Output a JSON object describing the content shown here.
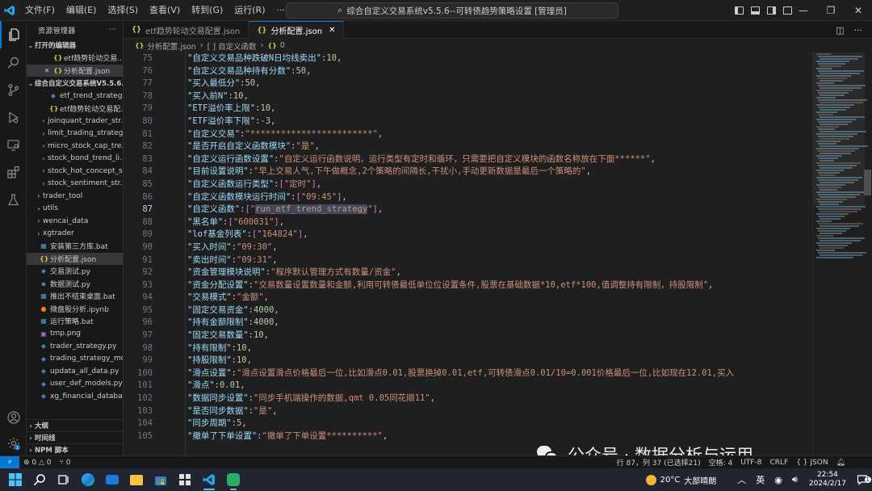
{
  "titlebar": {
    "menu": [
      "文件(F)",
      "编辑(E)",
      "选择(S)",
      "查看(V)",
      "转到(G)",
      "运行(R)",
      "···"
    ],
    "search_text": "综合自定义交易系统v5.5.6--可转债趋势策略设置 [管理员]"
  },
  "sidebar": {
    "title": "资源管理器",
    "more": "···",
    "open_editors_label": "打开的编辑器",
    "open_editors": [
      {
        "name": "etf趋势轮动交易...",
        "icon": "json",
        "closable": false
      },
      {
        "name": "分析配置.json",
        "icon": "json",
        "closable": true
      }
    ],
    "workspace_label": "综合自定义交易系统V5.5.6...",
    "tree": [
      {
        "name": "etf_trend_strategy....",
        "icon": "py",
        "depth": 2,
        "chev": ""
      },
      {
        "name": "etf趋势轮动交易配...",
        "icon": "json",
        "depth": 2,
        "chev": ""
      },
      {
        "name": "joinquant_trader_str...",
        "icon": "",
        "depth": 1,
        "chev": "›"
      },
      {
        "name": "limit_trading_strategy",
        "icon": "",
        "depth": 1,
        "chev": "›"
      },
      {
        "name": "micro_stock_cap_tre...",
        "icon": "",
        "depth": 1,
        "chev": "›"
      },
      {
        "name": "stock_bond_trend_li...",
        "icon": "",
        "depth": 1,
        "chev": "›"
      },
      {
        "name": "stock_hot_concept_s...",
        "icon": "",
        "depth": 1,
        "chev": "›"
      },
      {
        "name": "stock_sentiment_str...",
        "icon": "",
        "depth": 1,
        "chev": "›"
      },
      {
        "name": "trader_tool",
        "icon": "",
        "depth": 0,
        "chev": "›"
      },
      {
        "name": "utils",
        "icon": "",
        "depth": 0,
        "chev": "›"
      },
      {
        "name": "wencai_data",
        "icon": "",
        "depth": 0,
        "chev": "›"
      },
      {
        "name": "xgtrader",
        "icon": "",
        "depth": 0,
        "chev": "›"
      },
      {
        "name": "安装第三方库.bat",
        "icon": "bat",
        "depth": 0,
        "chev": ""
      },
      {
        "name": "分析配置.json",
        "icon": "json",
        "depth": 0,
        "chev": "",
        "active": true
      },
      {
        "name": "交易测试.py",
        "icon": "py",
        "depth": 0,
        "chev": ""
      },
      {
        "name": "数据测试.py",
        "icon": "py",
        "depth": 0,
        "chev": ""
      },
      {
        "name": "推出不结束桌面.bat",
        "icon": "bat",
        "depth": 0,
        "chev": ""
      },
      {
        "name": "微盘股分析.ipynb",
        "icon": "ipynb",
        "depth": 0,
        "chev": ""
      },
      {
        "name": "运行策略.bat",
        "icon": "bat",
        "depth": 0,
        "chev": ""
      },
      {
        "name": "tmp.png",
        "icon": "png",
        "depth": 0,
        "chev": ""
      },
      {
        "name": "trader_strategy.py",
        "icon": "py",
        "depth": 0,
        "chev": ""
      },
      {
        "name": "trading_strategy_mod...",
        "icon": "py",
        "depth": 0,
        "chev": ""
      },
      {
        "name": "updata_all_data.py",
        "icon": "py",
        "depth": 0,
        "chev": ""
      },
      {
        "name": "user_def_models.py",
        "icon": "py",
        "depth": 0,
        "chev": ""
      },
      {
        "name": "xg_financial_database...",
        "icon": "py",
        "depth": 0,
        "chev": ""
      }
    ],
    "bottom_sections": [
      "大纲",
      "时间线",
      "NPM 脚本"
    ]
  },
  "tabs": [
    {
      "label": "etf趋势轮动交易配置.json",
      "active": false
    },
    {
      "label": "分析配置.json",
      "active": true,
      "close": "✕"
    }
  ],
  "breadcrumb": {
    "file": "分析配置.json",
    "symbol": "[ ] 自定义函数",
    "count": "0"
  },
  "editor": {
    "current_line": 87,
    "lines": [
      {
        "n": "75",
        "k": "自定义交易品种跌破N日均线卖出",
        "v": "10",
        "t": "n"
      },
      {
        "n": "76",
        "k": "自定义交易品种持有分数",
        "v": "50",
        "t": "n"
      },
      {
        "n": "77",
        "k": "买入最低分",
        "v": "50",
        "t": "n"
      },
      {
        "n": "78",
        "k": "买入前N",
        "v": "10",
        "t": "n"
      },
      {
        "n": "79",
        "k": "ETF溢价率上限",
        "v": "10",
        "t": "n"
      },
      {
        "n": "80",
        "k": "ETF溢价率下限",
        "v": "-3",
        "t": "n"
      },
      {
        "n": "81",
        "k": "自定义交易",
        "v": "************************",
        "t": "s"
      },
      {
        "n": "82",
        "k": "是否开启自定义函数模块",
        "v": "是",
        "t": "s"
      },
      {
        "n": "83",
        "k": "自定义运行函数设置",
        "v": "自定义运行函数说明，运行类型有定时和循环，只需要把自定义模块的函数名称放在下面******",
        "t": "s"
      },
      {
        "n": "84",
        "k": "目前设置说明",
        "v": "早上交易人气,下午做概念,2个策略的间隔长,干扰小,手动更新数据是最后一个策略的",
        "t": "s"
      },
      {
        "n": "85",
        "k": "自定义函数运行类型",
        "v": "定时",
        "t": "a"
      },
      {
        "n": "86",
        "k": "自定义函数模块运行时间",
        "v": "09:45",
        "t": "a"
      },
      {
        "n": "87",
        "k": "自定义函数",
        "v": "run_etf_trend_strategy",
        "t": "a",
        "hl": true
      },
      {
        "n": "88",
        "k": "黑名单",
        "v": "600031",
        "t": "a"
      },
      {
        "n": "89",
        "k": "lof基金列表",
        "v": "164824",
        "t": "a"
      },
      {
        "n": "90",
        "k": "买入时间",
        "v": "09:30",
        "t": "s"
      },
      {
        "n": "91",
        "k": "卖出时间",
        "v": "09:31",
        "t": "s"
      },
      {
        "n": "92",
        "k": "资金管理模块说明",
        "v": "程序默认管理方式有数量/资金",
        "t": "s"
      },
      {
        "n": "93",
        "k": "资金分配设置",
        "v": "交易数量设置数量和金额,利用可转债最低单位位设置条件,股票在基础数据*10,etf*100,值调整持有限制，持股限制",
        "t": "s"
      },
      {
        "n": "94",
        "k": "交易模式",
        "v": "金额",
        "t": "s"
      },
      {
        "n": "95",
        "k": "固定交易资金",
        "v": "4000",
        "t": "n"
      },
      {
        "n": "96",
        "k": "持有金额限制",
        "v": "4000",
        "t": "n"
      },
      {
        "n": "97",
        "k": "固定交易数量",
        "v": "10",
        "t": "n"
      },
      {
        "n": "98",
        "k": "持有限制",
        "v": "10",
        "t": "n"
      },
      {
        "n": "99",
        "k": "持股限制",
        "v": "10",
        "t": "n"
      },
      {
        "n": "100",
        "k": "滑点设置",
        "v": "滑点设置滑点价格最后一位,比如滑点0.01,股票换掉0.01,etf,可转债滑点0.01/10=0.001价格最后一位,比如现在12.01,买入",
        "t": "s",
        "open": true
      },
      {
        "n": "101",
        "k": "滑点",
        "v": "0.01",
        "t": "n"
      },
      {
        "n": "102",
        "k": "数据同步设置",
        "v": "同步手机端操作的数据,qmt 0.05同花顺11",
        "t": "s"
      },
      {
        "n": "103",
        "k": "是否同步数据",
        "v": "是",
        "t": "s"
      },
      {
        "n": "104",
        "k": "同步周期",
        "v": "5",
        "t": "n"
      },
      {
        "n": "105",
        "k": "撤单了下单设置",
        "v": "撤单了下单设置**********",
        "t": "s"
      }
    ]
  },
  "watermark": {
    "text": "公众号 · 数据分析与运用"
  },
  "statusbar": {
    "remote": "⚡",
    "errors": "⊗ 0 △ 0",
    "ports": "⑂ 0",
    "position": "行 87，列 37 (已选择21)",
    "spaces": "空格: 4",
    "encoding": "UTF-8",
    "eol": "CRLF",
    "language": "{ } JSON"
  },
  "taskbar": {
    "weather_temp": "20°C",
    "weather_text": "大部晴朗",
    "ime": "英",
    "time": "22:54",
    "date": "2024/2/17",
    "notif_count": "1"
  }
}
